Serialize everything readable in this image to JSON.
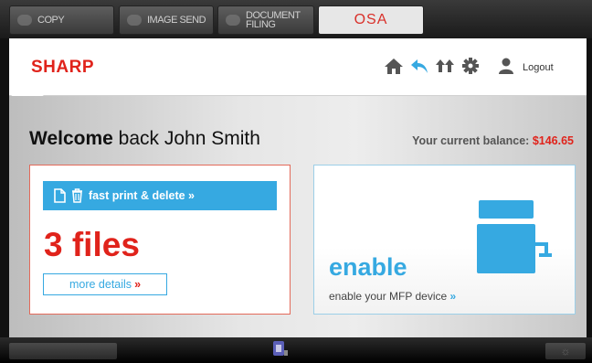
{
  "modes": [
    {
      "label": "COPY",
      "icon": "copy-icon"
    },
    {
      "label": "IMAGE SEND",
      "icon": "image-send-icon"
    },
    {
      "label": "DOCUMENT\nFILING",
      "icon": "document-filing-icon"
    },
    {
      "label": "OSA",
      "icon": "osa-logo"
    }
  ],
  "header": {
    "brand": "SHARP",
    "icons": [
      "home-icon",
      "back-icon",
      "swap-icon",
      "gear-icon",
      "user-icon"
    ],
    "logout_label": "Logout"
  },
  "main": {
    "welcome_bold": "Welcome",
    "welcome_rest": " back John Smith",
    "balance_label": "Your current balance: ",
    "balance_amount": "$146.65",
    "print_card": {
      "button_label": "fast print & delete »",
      "files_text": "3 files",
      "details_label": "more details",
      "details_chevron": "»"
    },
    "enable_card": {
      "title": "enable",
      "description": "enable your MFP device ",
      "chevron": "»"
    }
  },
  "colors": {
    "brand_red": "#e0231b",
    "accent_blue": "#36a9e1"
  }
}
